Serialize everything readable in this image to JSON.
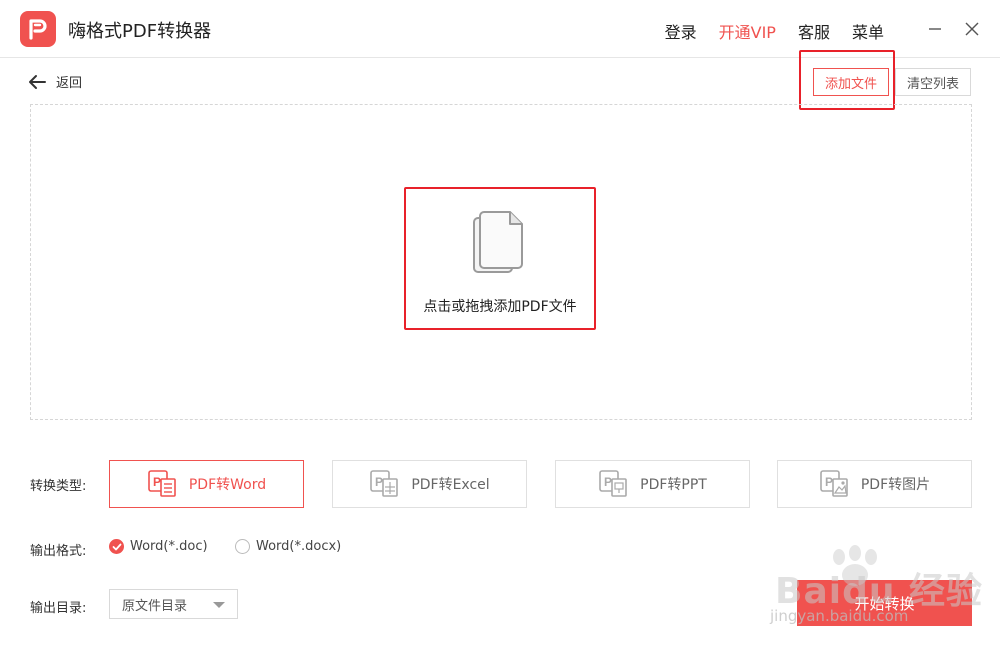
{
  "app": {
    "title": "嗨格式PDF转换器",
    "logo_letter": "P"
  },
  "top_nav": {
    "login": "登录",
    "vip": "开通VIP",
    "service": "客服",
    "menu": "菜单"
  },
  "toolbar": {
    "back": "返回",
    "add_file": "添加文件",
    "clear_list": "清空列表"
  },
  "dropzone": {
    "prompt": "点击或拖拽添加PDF文件"
  },
  "convert_type": {
    "label": "转换类型:",
    "options": [
      {
        "label": "PDF转Word",
        "active": true
      },
      {
        "label": "PDF转Excel",
        "active": false
      },
      {
        "label": "PDF转PPT",
        "active": false
      },
      {
        "label": "PDF转图片",
        "active": false
      }
    ]
  },
  "output_format": {
    "label": "输出格式:",
    "options": [
      {
        "label": "Word(*.doc)",
        "checked": true
      },
      {
        "label": "Word(*.docx)",
        "checked": false
      }
    ]
  },
  "output_dir": {
    "label": "输出目录:",
    "value": "原文件目录"
  },
  "start_button": "开始转换",
  "watermark": {
    "brand": "Baidu 经验",
    "url": "jingyan.baidu.com"
  },
  "colors": {
    "accent": "#f0524f",
    "highlight": "#e8212a"
  }
}
